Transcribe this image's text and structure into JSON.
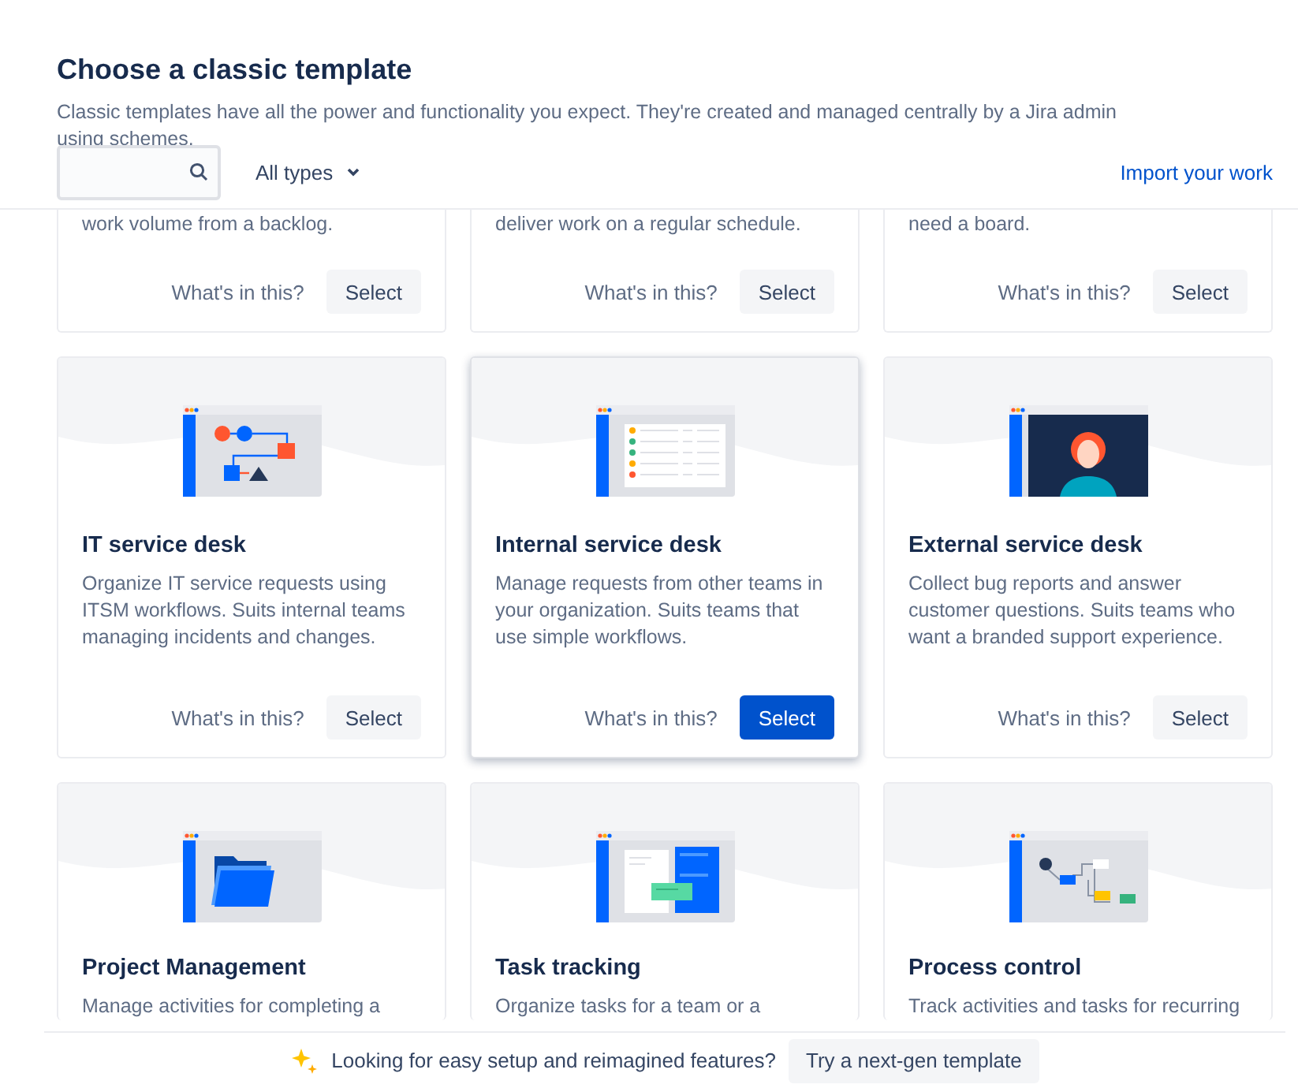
{
  "header": {
    "title": "Choose a classic template",
    "description": "Classic templates have all the power and functionality you expect. They're created and managed centrally by a Jira admin using schemes.",
    "filter": "All types",
    "import_link": "Import your work"
  },
  "templates": [
    {
      "kind": "partial",
      "description": "work volume from a backlog.",
      "more": "What's in this?",
      "select": "Select",
      "selected": false
    },
    {
      "kind": "partial",
      "description": "deliver work on a regular schedule.",
      "more": "What's in this?",
      "select": "Select",
      "selected": false
    },
    {
      "kind": "partial",
      "description": "need a board.",
      "more": "What's in this?",
      "select": "Select",
      "selected": false
    },
    {
      "kind": "workflow",
      "title": "IT service desk",
      "description": "Organize IT service requests using ITSM workflows. Suits internal teams managing incidents and changes.",
      "more": "What's in this?",
      "select": "Select",
      "selected": false
    },
    {
      "kind": "list",
      "title": "Internal service desk",
      "description": "Manage requests from other teams in your organization. Suits teams that use simple workflows.",
      "more": "What's in this?",
      "select": "Select",
      "selected": true
    },
    {
      "kind": "person",
      "title": "External service desk",
      "description": "Collect bug reports and answer customer questions. Suits teams who want a branded support experience.",
      "more": "What's in this?",
      "select": "Select",
      "selected": false
    },
    {
      "kind": "folder",
      "title": "Project Management",
      "description": "Manage activities for completing a"
    },
    {
      "kind": "board",
      "title": "Task tracking",
      "description": "Organize tasks for a team or a"
    },
    {
      "kind": "process",
      "title": "Process control",
      "description": "Track activities and tasks for recurring"
    }
  ],
  "footer": {
    "text": "Looking for easy setup and reimagined features?",
    "button": "Try a next-gen template"
  }
}
